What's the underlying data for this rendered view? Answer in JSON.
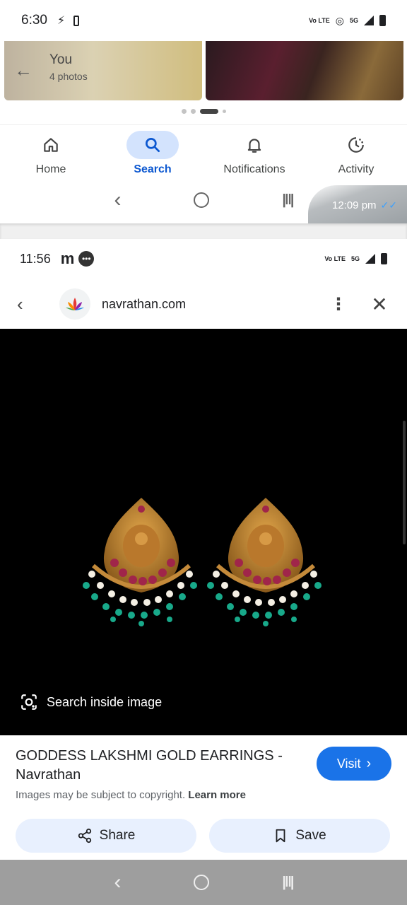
{
  "screenA": {
    "status": {
      "time": "6:30",
      "volte": "Vo LTE",
      "net": "5G"
    },
    "album": {
      "title": "You",
      "subtitle": "4 photos"
    },
    "nav": [
      {
        "label": "Home",
        "icon": "home-icon",
        "active": false
      },
      {
        "label": "Search",
        "icon": "search-icon",
        "active": true
      },
      {
        "label": "Notifications",
        "icon": "bell-icon",
        "active": false
      },
      {
        "label": "Activity",
        "icon": "activity-icon",
        "active": false
      }
    ],
    "chat_timestamp": "12:09 pm"
  },
  "screenB": {
    "status": {
      "time": "11:56",
      "volte": "Vo LTE",
      "net": "5G",
      "app_glyph": "m"
    },
    "browser": {
      "site": "navrathan.com"
    },
    "lens": {
      "label": "Search inside image"
    },
    "result": {
      "title": "GODDESS LAKSHMI GOLD EARRINGS - Navrathan",
      "visit": "Visit",
      "copyright": "Images may be subject to copyright.",
      "learn_more": "Learn more"
    },
    "actions": {
      "share": "Share",
      "save": "Save"
    }
  },
  "colors": {
    "accent": "#1a73e8",
    "active_nav_bg": "#d3e3fd",
    "active_nav_text": "#0b57d0",
    "button_bg": "#e8f0fe"
  }
}
